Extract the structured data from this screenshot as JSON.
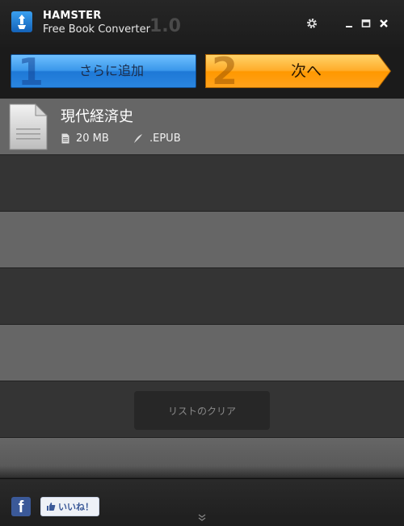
{
  "app": {
    "name": "HAMSTER",
    "subtitle": "Free Book Converter",
    "version": "1.0"
  },
  "window_controls": [
    "gear-icon",
    "minimize-icon",
    "maximize-icon",
    "close-icon"
  ],
  "steps": [
    {
      "number": "1",
      "label": "さらに追加",
      "color": "#2a86e0"
    },
    {
      "number": "2",
      "label": "次へ",
      "color": "#ff9f1a"
    }
  ],
  "files": [
    {
      "title": "現代経済史",
      "size": "20 MB",
      "format": ".EPUB"
    }
  ],
  "clear_list_label": "リストのクリア",
  "footer": {
    "facebook_glyph": "f",
    "like_label": "いいね！"
  }
}
